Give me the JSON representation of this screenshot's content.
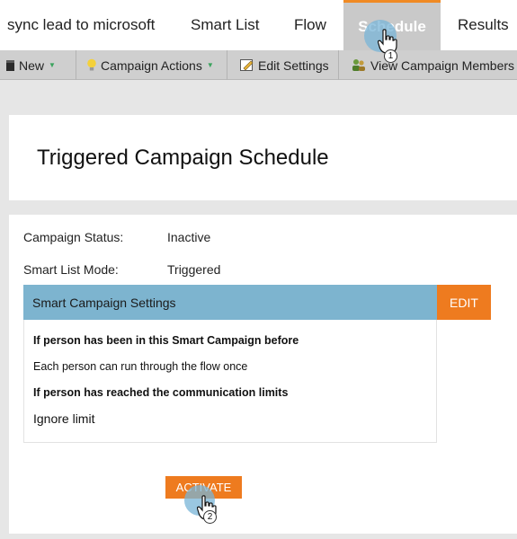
{
  "tabs": {
    "campaign_name": "sync lead to microsoft",
    "smart_list": "Smart List",
    "flow": "Flow",
    "schedule": "Schedule",
    "results": "Results"
  },
  "toolbar": {
    "new_label": "New",
    "campaign_actions_label": "Campaign Actions",
    "edit_settings_label": "Edit Settings",
    "view_members_label": "View Campaign Members"
  },
  "page": {
    "title": "Triggered Campaign Schedule"
  },
  "details": {
    "status_key": "Campaign Status:",
    "status_value": "Inactive",
    "mode_key": "Smart List Mode:",
    "mode_value": "Triggered"
  },
  "settings": {
    "header": "Smart Campaign Settings",
    "edit_label": "EDIT",
    "q1": "If person has been in this Smart Campaign before",
    "a1": "Each person can run through the flow once",
    "q2": "If person has reached the communication limits",
    "a2": "Ignore limit"
  },
  "activate_label": "ACTIVATE",
  "cursors": {
    "step1": "1",
    "step2": "2"
  },
  "colors": {
    "accent_orange": "#ee7b1f",
    "settings_header_blue": "#7db4cf",
    "active_tab_gray": "#c9c9c9"
  }
}
